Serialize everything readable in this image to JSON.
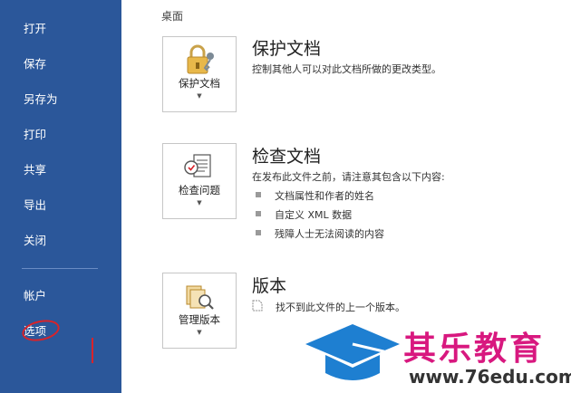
{
  "sidebar": {
    "items": [
      {
        "label": "打开"
      },
      {
        "label": "保存"
      },
      {
        "label": "另存为"
      },
      {
        "label": "打印"
      },
      {
        "label": "共享"
      },
      {
        "label": "导出"
      },
      {
        "label": "关闭"
      },
      {
        "label": "帐户"
      },
      {
        "label": "选项"
      }
    ]
  },
  "main": {
    "top_title_partial": "———·——·——·——— ·——",
    "location": "桌面",
    "protect": {
      "tile_label": "保护文档",
      "title": "保护文档",
      "description": "控制其他人可以对此文档所做的更改类型。"
    },
    "inspect": {
      "tile_label": "检查问题",
      "title": "检查文档",
      "description": "在发布此文件之前，请注意其包含以下内容:",
      "bullets": [
        "文档属性和作者的姓名",
        "自定义 XML 数据",
        "残障人士无法阅读的内容"
      ]
    },
    "versions": {
      "tile_label": "管理版本",
      "title": "版本",
      "description": "找不到此文件的上一个版本。"
    }
  },
  "watermark": {
    "brand": "其乐教育",
    "url": "www.76edu.com"
  },
  "colors": {
    "sidebar_bg": "#2b579a",
    "annotation_red": "#d8232a",
    "brand_pink": "#d8187f",
    "brand_blue": "#1e7fd1"
  }
}
